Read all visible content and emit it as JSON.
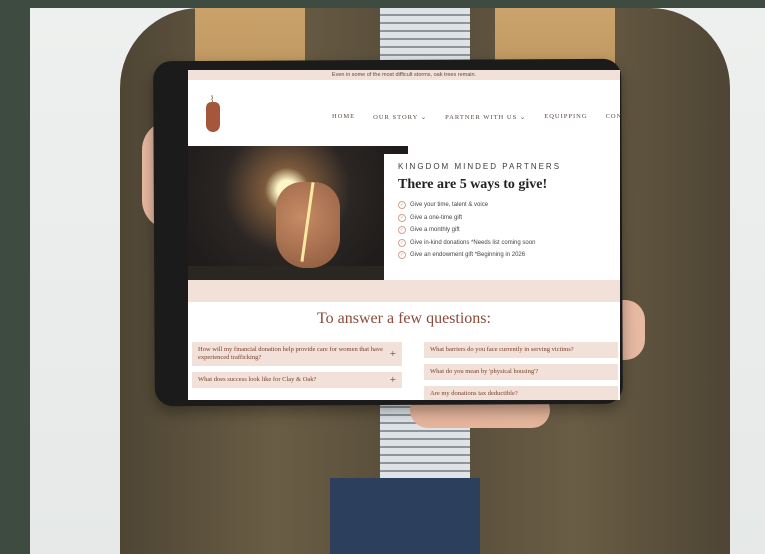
{
  "site": {
    "top_banner": "Even in some of the most difficult storms, oak trees remain.",
    "nav": [
      "HOME",
      "OUR STORY ⌄",
      "PARTNER WITH US ⌄",
      "EQUIPPING",
      "CONTA"
    ]
  },
  "partners": {
    "label": "KINGDOM MINDED PARTNERS",
    "heading": "There are 5 ways to give!",
    "items": [
      "Give your time, talent & voice",
      "Give a one-time gift",
      "Give a monthly gift",
      "Give in-kind donations *Needs list coming soon",
      "Give an endowment gift *Beginning in 2026"
    ]
  },
  "faq": {
    "title": "To answer a few questions:",
    "left": [
      "How will my financial donation help provide care for women that have experienced trafficking?",
      "What does success look like for Clay & Oak?"
    ],
    "right": [
      "What barriers do you face currently in serving victims?",
      "What do you mean by 'physical housing'?",
      "Are my donations tax deductible?"
    ],
    "plus": "+"
  },
  "colors": {
    "accent": "#8a4b39",
    "panel": "#f1e1d8",
    "background": "#3d4b40"
  }
}
